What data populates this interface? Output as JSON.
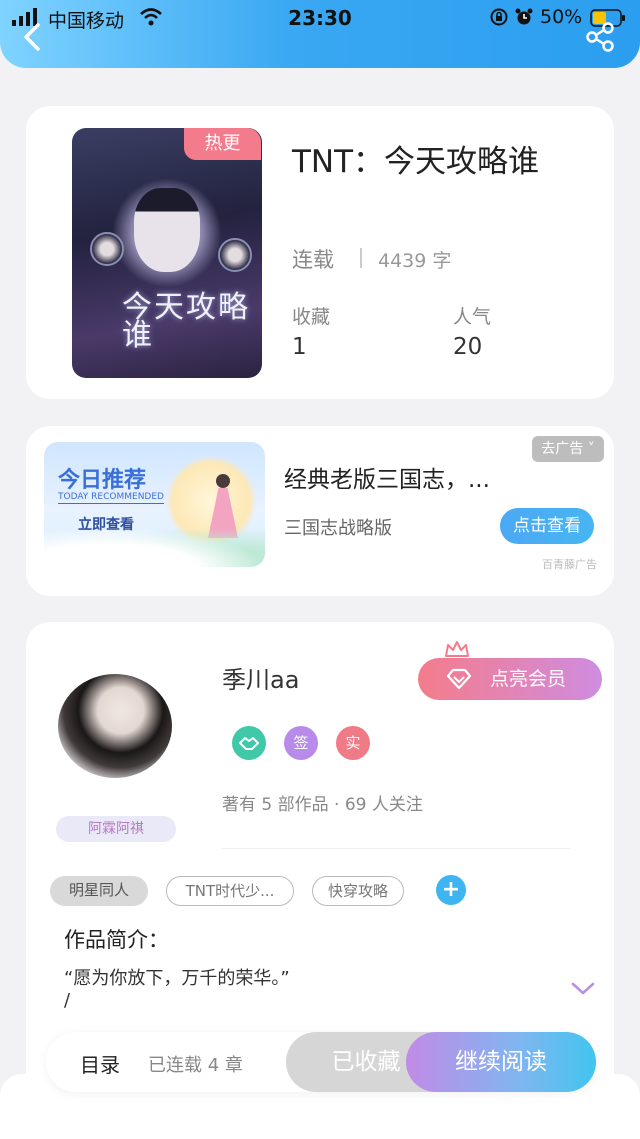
{
  "status_bar": {
    "carrier": "中国移动",
    "time": "23:30",
    "battery_percent": "50%",
    "battery_level": 0.5
  },
  "book": {
    "hot_badge": "热更",
    "title": "TNT：今天攻略谁",
    "status": "连载",
    "word_count": "4439 字",
    "favorites_label": "收藏",
    "favorites_value": "1",
    "popularity_label": "人气",
    "popularity_value": "20",
    "cover_text": "今天攻略谁"
  },
  "ad": {
    "banner_title": "今日推荐",
    "banner_subtitle": "TODAY RECOMMENDED",
    "banner_cta": "立即查看",
    "close_label": "去广告 ˅",
    "title": "经典老版三国志，...",
    "subtitle": "三国志战略版",
    "cta_label": "点击查看",
    "source": "百青藤广告"
  },
  "author": {
    "name": "季川aa",
    "vip_label": "点亮会员",
    "badges": [
      "",
      "签",
      "实"
    ],
    "stats": "著有 5 部作品 · 69 人关注",
    "fan_tag": "阿霖阿祺",
    "tags": [
      "明星同人",
      "TNT时代少...",
      "快穿攻略"
    ],
    "add_tag_label": "+",
    "intro_heading": "作品简介：",
    "intro_text": "“愿为你放下，万千的荣华。”",
    "intro_slash": "/"
  },
  "action_bar": {
    "toc_label": "目录",
    "toc_count": "已连载 4 章",
    "collected_label": "已收藏",
    "read_label": "继续阅读"
  },
  "colors": {
    "header_blue": "#2b9ef0",
    "hot_badge": "#f47b8c",
    "vip_pink": "#f47c8a",
    "read_gradient_end": "#41c5ef"
  }
}
